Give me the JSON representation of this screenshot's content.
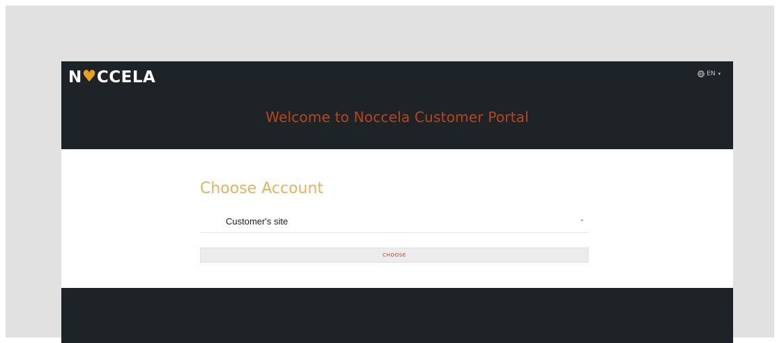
{
  "header": {
    "logo_prefix": "N",
    "logo_pin": "♥",
    "logo_suffix": "CCELA",
    "language": "EN",
    "welcome": "Welcome to Noccela Customer Portal"
  },
  "account": {
    "title": "Choose Account",
    "selected_site": "Customer's site",
    "choose_label": "CHOOSE"
  },
  "icons": {
    "language": "globe-icon",
    "dropdown": "chevron-down-icon"
  },
  "colors": {
    "dark_bg": "#1e2328",
    "welcome_text": "#b8461c",
    "title_text": "#e3b260",
    "button_text": "#c0392b",
    "logo_accent": "#e8a020"
  }
}
